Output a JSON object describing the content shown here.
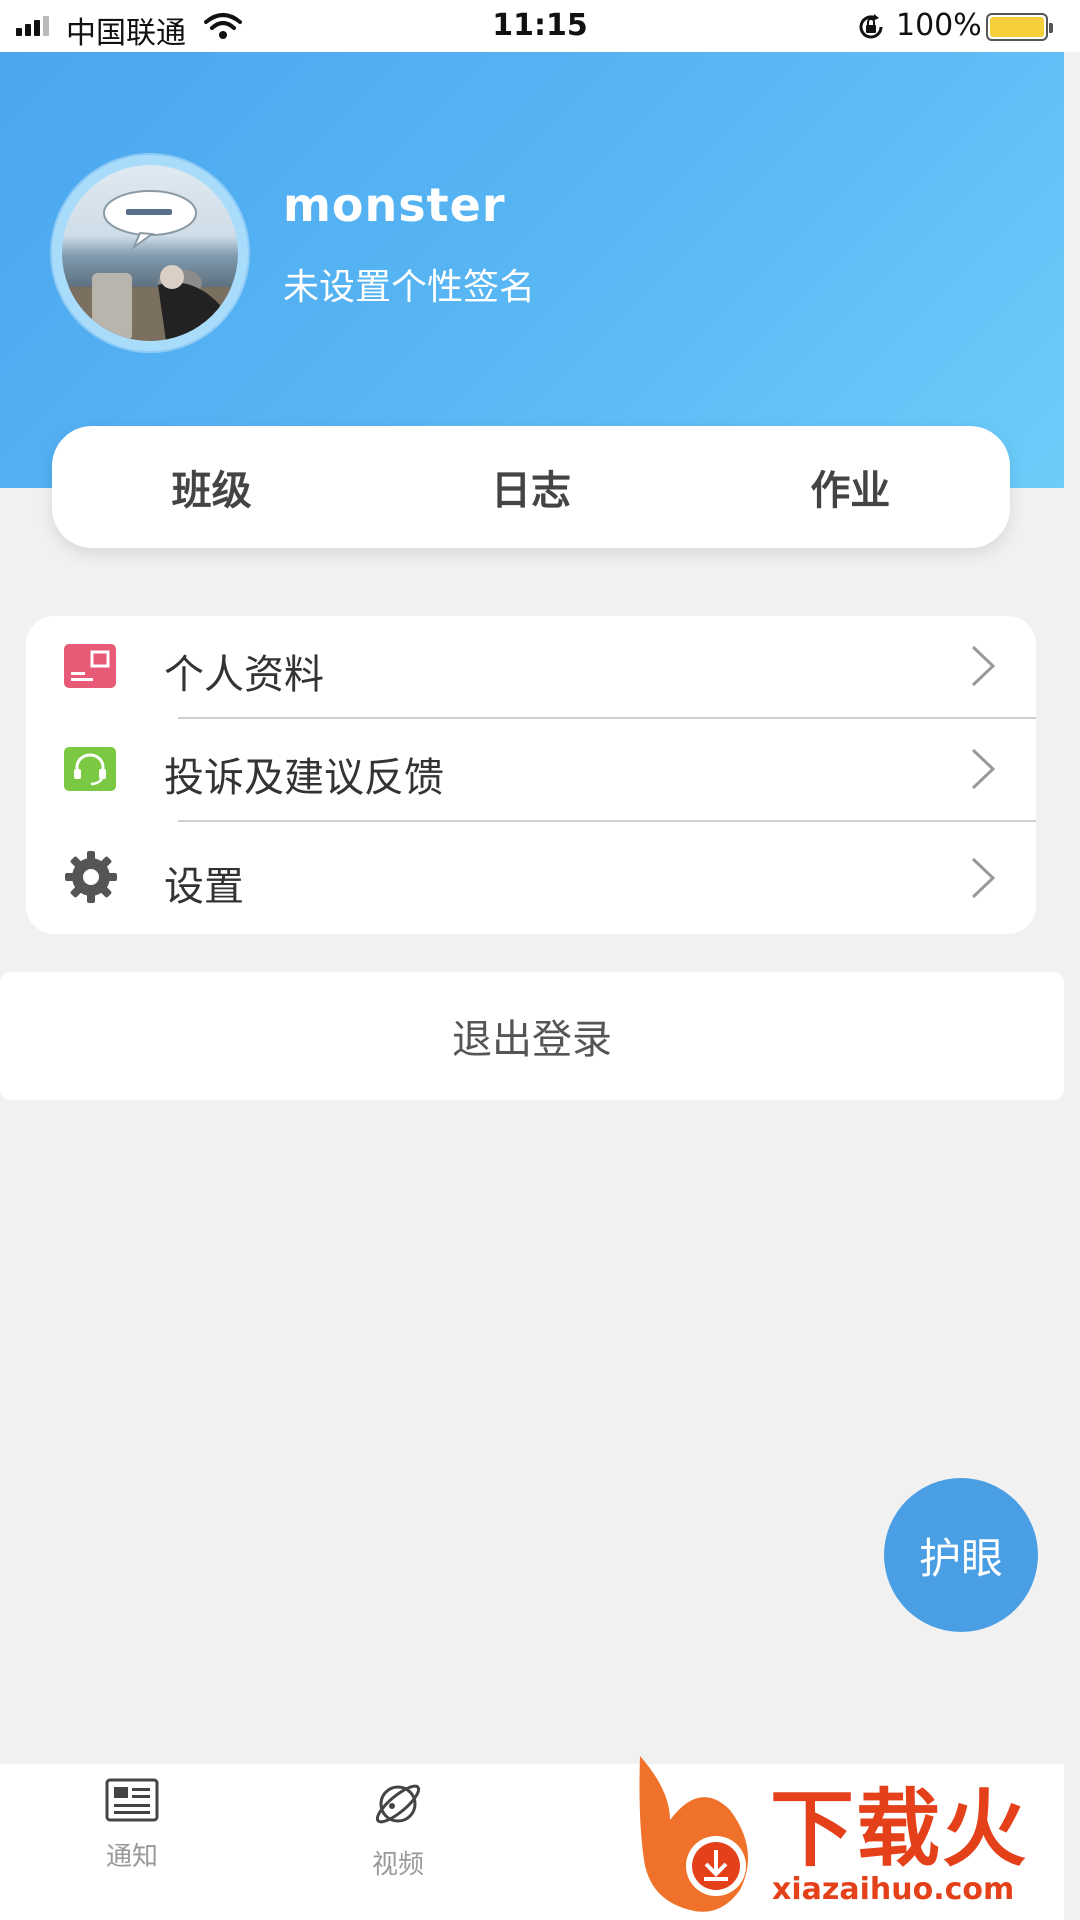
{
  "status_bar": {
    "carrier": "中国联通",
    "time": "11:15",
    "battery_percent": "100%",
    "battery_level": 1.0
  },
  "profile": {
    "name": "monster",
    "signature": "未设置个性签名"
  },
  "tabs": [
    {
      "label": "班级"
    },
    {
      "label": "日志"
    },
    {
      "label": "作业"
    }
  ],
  "menu": [
    {
      "label": "个人资料",
      "icon": "profile-card-icon",
      "color": "#e85a75"
    },
    {
      "label": "投诉及建议反馈",
      "icon": "headset-icon",
      "color": "#7bc943"
    },
    {
      "label": "设置",
      "icon": "gear-icon",
      "color": "#555555"
    }
  ],
  "logout_label": "退出登录",
  "fab_label": "护眼",
  "bottom_nav": [
    {
      "label": "通知",
      "icon": "newspaper-icon"
    },
    {
      "label": "视频",
      "icon": "planet-icon"
    }
  ],
  "watermark": {
    "text": "下载火",
    "url": "xiazaihuo.com"
  },
  "colors": {
    "header_gradient_start": "#4aa6ef",
    "header_gradient_end": "#6ccdfa",
    "fab": "#4a9fe4",
    "background": "#f1f1f1"
  }
}
